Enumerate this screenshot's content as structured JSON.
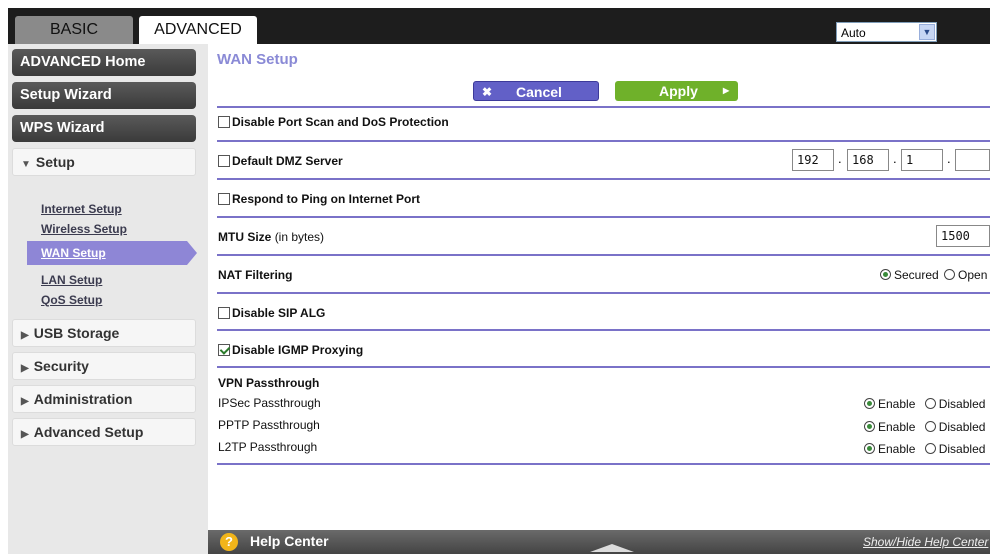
{
  "tabs": {
    "basic": "BASIC",
    "advanced": "ADVANCED"
  },
  "language_select": {
    "value": "Auto"
  },
  "sidebar": {
    "advanced_home": "ADVANCED Home",
    "setup_wizard": "Setup Wizard",
    "wps_wizard": "WPS Wizard",
    "setup": "Setup",
    "setup_links": [
      "Internet Setup",
      "Wireless Setup",
      "WAN Setup",
      "LAN Setup",
      "QoS Setup"
    ],
    "usb_storage": "USB Storage",
    "security": "Security",
    "administration": "Administration",
    "advanced_setup": "Advanced Setup"
  },
  "page": {
    "title": "WAN Setup",
    "cancel": "Cancel",
    "apply": "Apply"
  },
  "settings": {
    "disable_port_scan": {
      "label": "Disable Port Scan and DoS Protection",
      "checked": false
    },
    "default_dmz": {
      "label": "Default DMZ Server",
      "checked": false,
      "ip": [
        "192",
        "168",
        "1",
        ""
      ]
    },
    "respond_ping": {
      "label": "Respond to Ping on Internet Port",
      "checked": false
    },
    "mtu": {
      "label": "MTU Size",
      "unit": "(in bytes)",
      "value": "1500"
    },
    "nat_filtering": {
      "label": "NAT Filtering",
      "options": [
        "Secured",
        "Open"
      ],
      "selected": "Secured"
    },
    "disable_sip_alg": {
      "label": "Disable SIP ALG",
      "checked": false
    },
    "disable_igmp": {
      "label": "Disable IGMP Proxying",
      "checked": true
    }
  },
  "vpn": {
    "title": "VPN Passthrough",
    "rows": [
      {
        "label": "IPSec Passthrough",
        "enable": "Enable",
        "disable": "Disabled",
        "selected": "Enable"
      },
      {
        "label": "PPTP Passthrough",
        "enable": "Enable",
        "disable": "Disabled",
        "selected": "Enable"
      },
      {
        "label": "L2TP Passthrough",
        "enable": "Enable",
        "disable": "Disabled",
        "selected": "Enable"
      }
    ]
  },
  "footer": {
    "help_center": "Help Center",
    "show_hide": "Show/Hide Help Center"
  },
  "colors": {
    "accent": "#7a72c8",
    "apply": "#6fb12a",
    "cancel": "#6260c7",
    "help_icon": "#f2b51a"
  }
}
